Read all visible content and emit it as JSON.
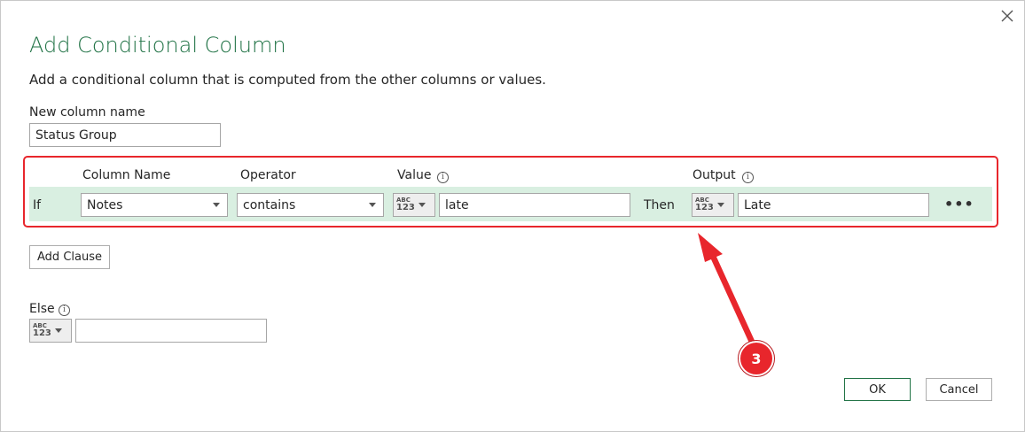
{
  "dialog": {
    "title": "Add Conditional Column",
    "description": "Add a conditional column that is computed from the other columns or values.",
    "close_icon": "close-icon"
  },
  "new_column": {
    "label": "New column name",
    "value": "Status Group"
  },
  "clause_headers": {
    "column_name": "Column Name",
    "operator": "Operator",
    "value": "Value",
    "output": "Output"
  },
  "clause": {
    "if_label": "If",
    "column_name": "Notes",
    "operator": "contains",
    "value_type_abc": "ABC",
    "value_type_num": "123",
    "value": "late",
    "then_label": "Then",
    "output_type_abc": "ABC",
    "output_type_num": "123",
    "output": "Late",
    "more_label": "•••"
  },
  "add_clause_label": "Add Clause",
  "else": {
    "label": "Else",
    "type_abc": "ABC",
    "type_num": "123",
    "value": ""
  },
  "buttons": {
    "ok": "OK",
    "cancel": "Cancel"
  },
  "annotation": {
    "step_number": "3",
    "color": "#e8262c"
  },
  "colors": {
    "accent": "#217346",
    "clause_band": "#d9efe1",
    "highlight": "#e8262c"
  }
}
